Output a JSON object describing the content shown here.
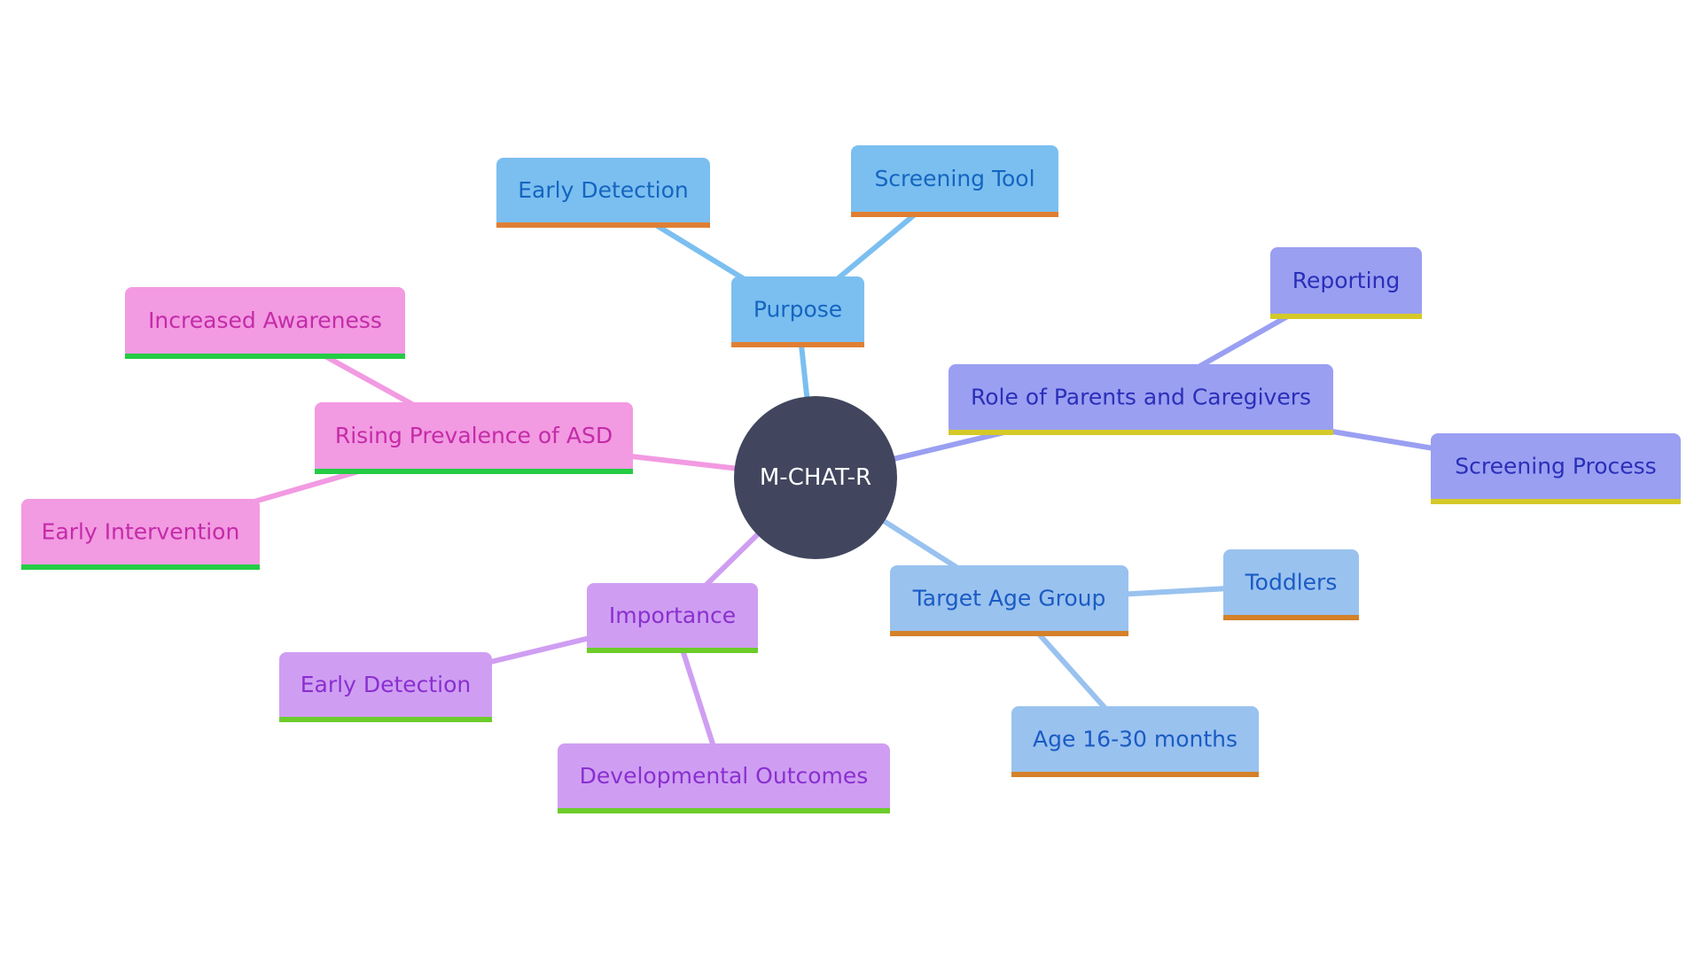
{
  "root": {
    "label": "M-CHAT-R",
    "color": "#41465e",
    "text_color": "#ffffff"
  },
  "branches": [
    {
      "id": "purpose",
      "label": "Purpose",
      "fill": "#7bbff0",
      "text": "#1565c0",
      "line": "#7bbff0",
      "underline": "#e07f33",
      "children": [
        {
          "id": "purpose-early-detection",
          "label": "Early Detection"
        },
        {
          "id": "purpose-screening-tool",
          "label": "Screening Tool"
        }
      ]
    },
    {
      "id": "role-of-parents",
      "label": "Role of Parents and Caregivers",
      "fill": "#9a9ff2",
      "text": "#2a2fb8",
      "line": "#9a9ff2",
      "underline": "#d4c928",
      "children": [
        {
          "id": "reporting",
          "label": "Reporting"
        },
        {
          "id": "screening-process",
          "label": "Screening Process"
        }
      ]
    },
    {
      "id": "target-age-group",
      "label": "Target Age Group",
      "fill": "#99c2ef",
      "text": "#1a5bc4",
      "line": "#99c2ef",
      "underline": "#d4812a",
      "children": [
        {
          "id": "toddlers",
          "label": "Toddlers"
        },
        {
          "id": "age-16-30-months",
          "label": "Age 16-30 months"
        }
      ]
    },
    {
      "id": "importance",
      "label": "Importance",
      "fill": "#cf9ef2",
      "text": "#8a2fd0",
      "line": "#cf9ef2",
      "underline": "#6ccc2a",
      "children": [
        {
          "id": "importance-early-detection",
          "label": "Early Detection"
        },
        {
          "id": "developmental-outcomes",
          "label": "Developmental Outcomes"
        }
      ]
    },
    {
      "id": "rising-prevalence",
      "label": "Rising Prevalence of ASD",
      "fill": "#f29ae2",
      "text": "#c42ba8",
      "line": "#f29ae2",
      "underline": "#24cc44",
      "children": [
        {
          "id": "increased-awareness",
          "label": "Increased Awareness"
        },
        {
          "id": "early-intervention",
          "label": "Early Intervention"
        }
      ]
    }
  ]
}
